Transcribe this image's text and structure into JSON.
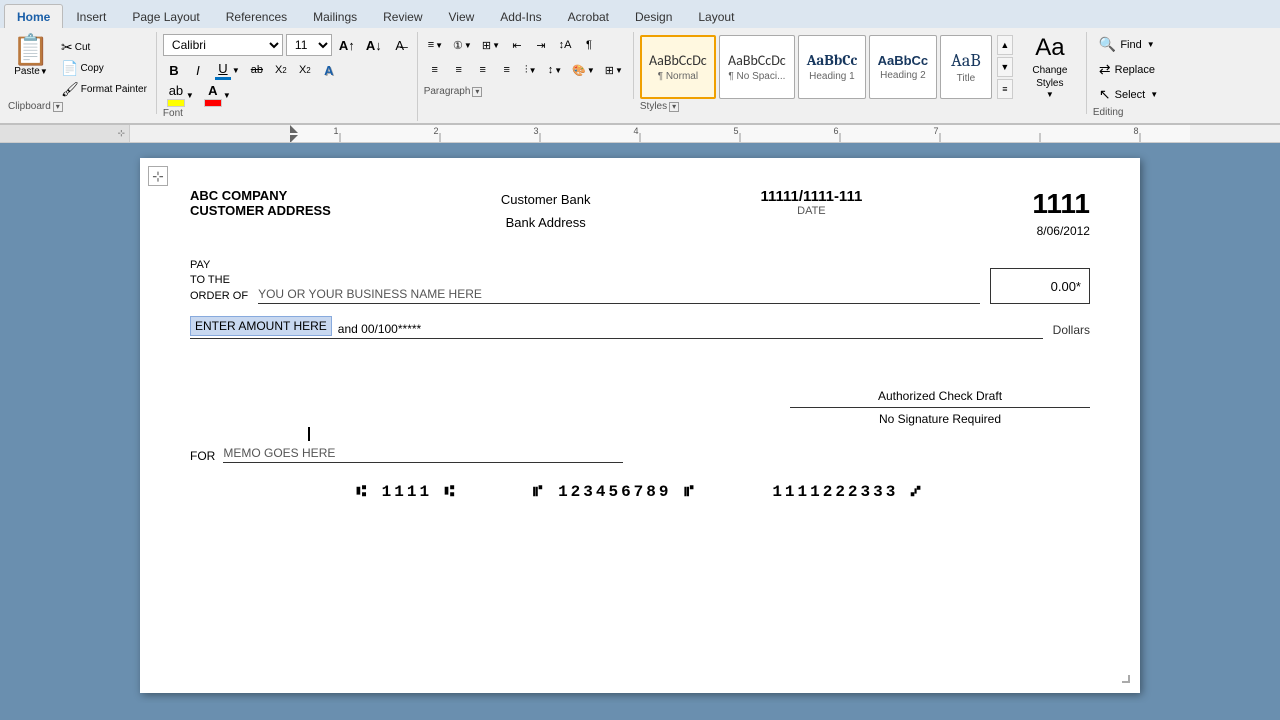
{
  "ribbon": {
    "tabs": [
      "Home",
      "Insert",
      "Page Layout",
      "References",
      "Mailings",
      "Review",
      "View",
      "Add-Ins",
      "Acrobat",
      "Design",
      "Layout"
    ],
    "active_tab": "Home",
    "font": {
      "name": "Calibri",
      "size": "11",
      "group_label": "Font"
    },
    "paragraph": {
      "group_label": "Paragraph"
    },
    "styles": {
      "group_label": "Styles",
      "items": [
        {
          "label": "¶ Normal",
          "sample_class": "style-normal-text",
          "sample": "AaBbCcDc",
          "active": true
        },
        {
          "label": "¶ No Spaci...",
          "sample_class": "style-nospace-text",
          "sample": "AaBbCcDc",
          "active": false
        },
        {
          "label": "Heading 1",
          "sample_class": "style-h1-text",
          "sample": "AaBbCc",
          "active": false
        },
        {
          "label": "Heading 2",
          "sample_class": "style-h2-text",
          "sample": "AaBbCc",
          "active": false
        },
        {
          "label": "Title",
          "sample_class": "style-title-text",
          "sample": "AaB",
          "active": false
        }
      ],
      "change_styles_label": "Change\nStyles"
    },
    "editing": {
      "group_label": "Editing",
      "find_label": "Find",
      "replace_label": "Replace",
      "select_label": "Select"
    }
  },
  "check": {
    "company_name": "ABC COMPANY",
    "company_address": "CUSTOMER ADDRESS",
    "bank_name": "Customer Bank",
    "bank_address": "Bank Address",
    "routing_number": "11111/1111-111",
    "check_number": "1111",
    "date_label": "DATE",
    "date_value": "8/06/2012",
    "pay_label_line1": "PAY",
    "pay_label_line2": "TO THE",
    "pay_label_line3": "ORDER OF",
    "payee_placeholder": "YOU OR YOUR BUSINESS NAME HERE",
    "amount_value": "0.00*",
    "amount_words_highlighted": "ENTER AMOUNT HERE",
    "amount_words_rest": "and 00/100*****",
    "dollars_label": "Dollars",
    "authorized_line1": "Authorized Check Draft",
    "authorized_line2": "No Signature Required",
    "memo_label": "FOR",
    "memo_placeholder": "MEMO GOES HERE",
    "micr_part1": "⑆ 1111 ⑆",
    "micr_part2": "⑈ 123456789 ⑈",
    "micr_part3": "1111222333 ⑇"
  }
}
